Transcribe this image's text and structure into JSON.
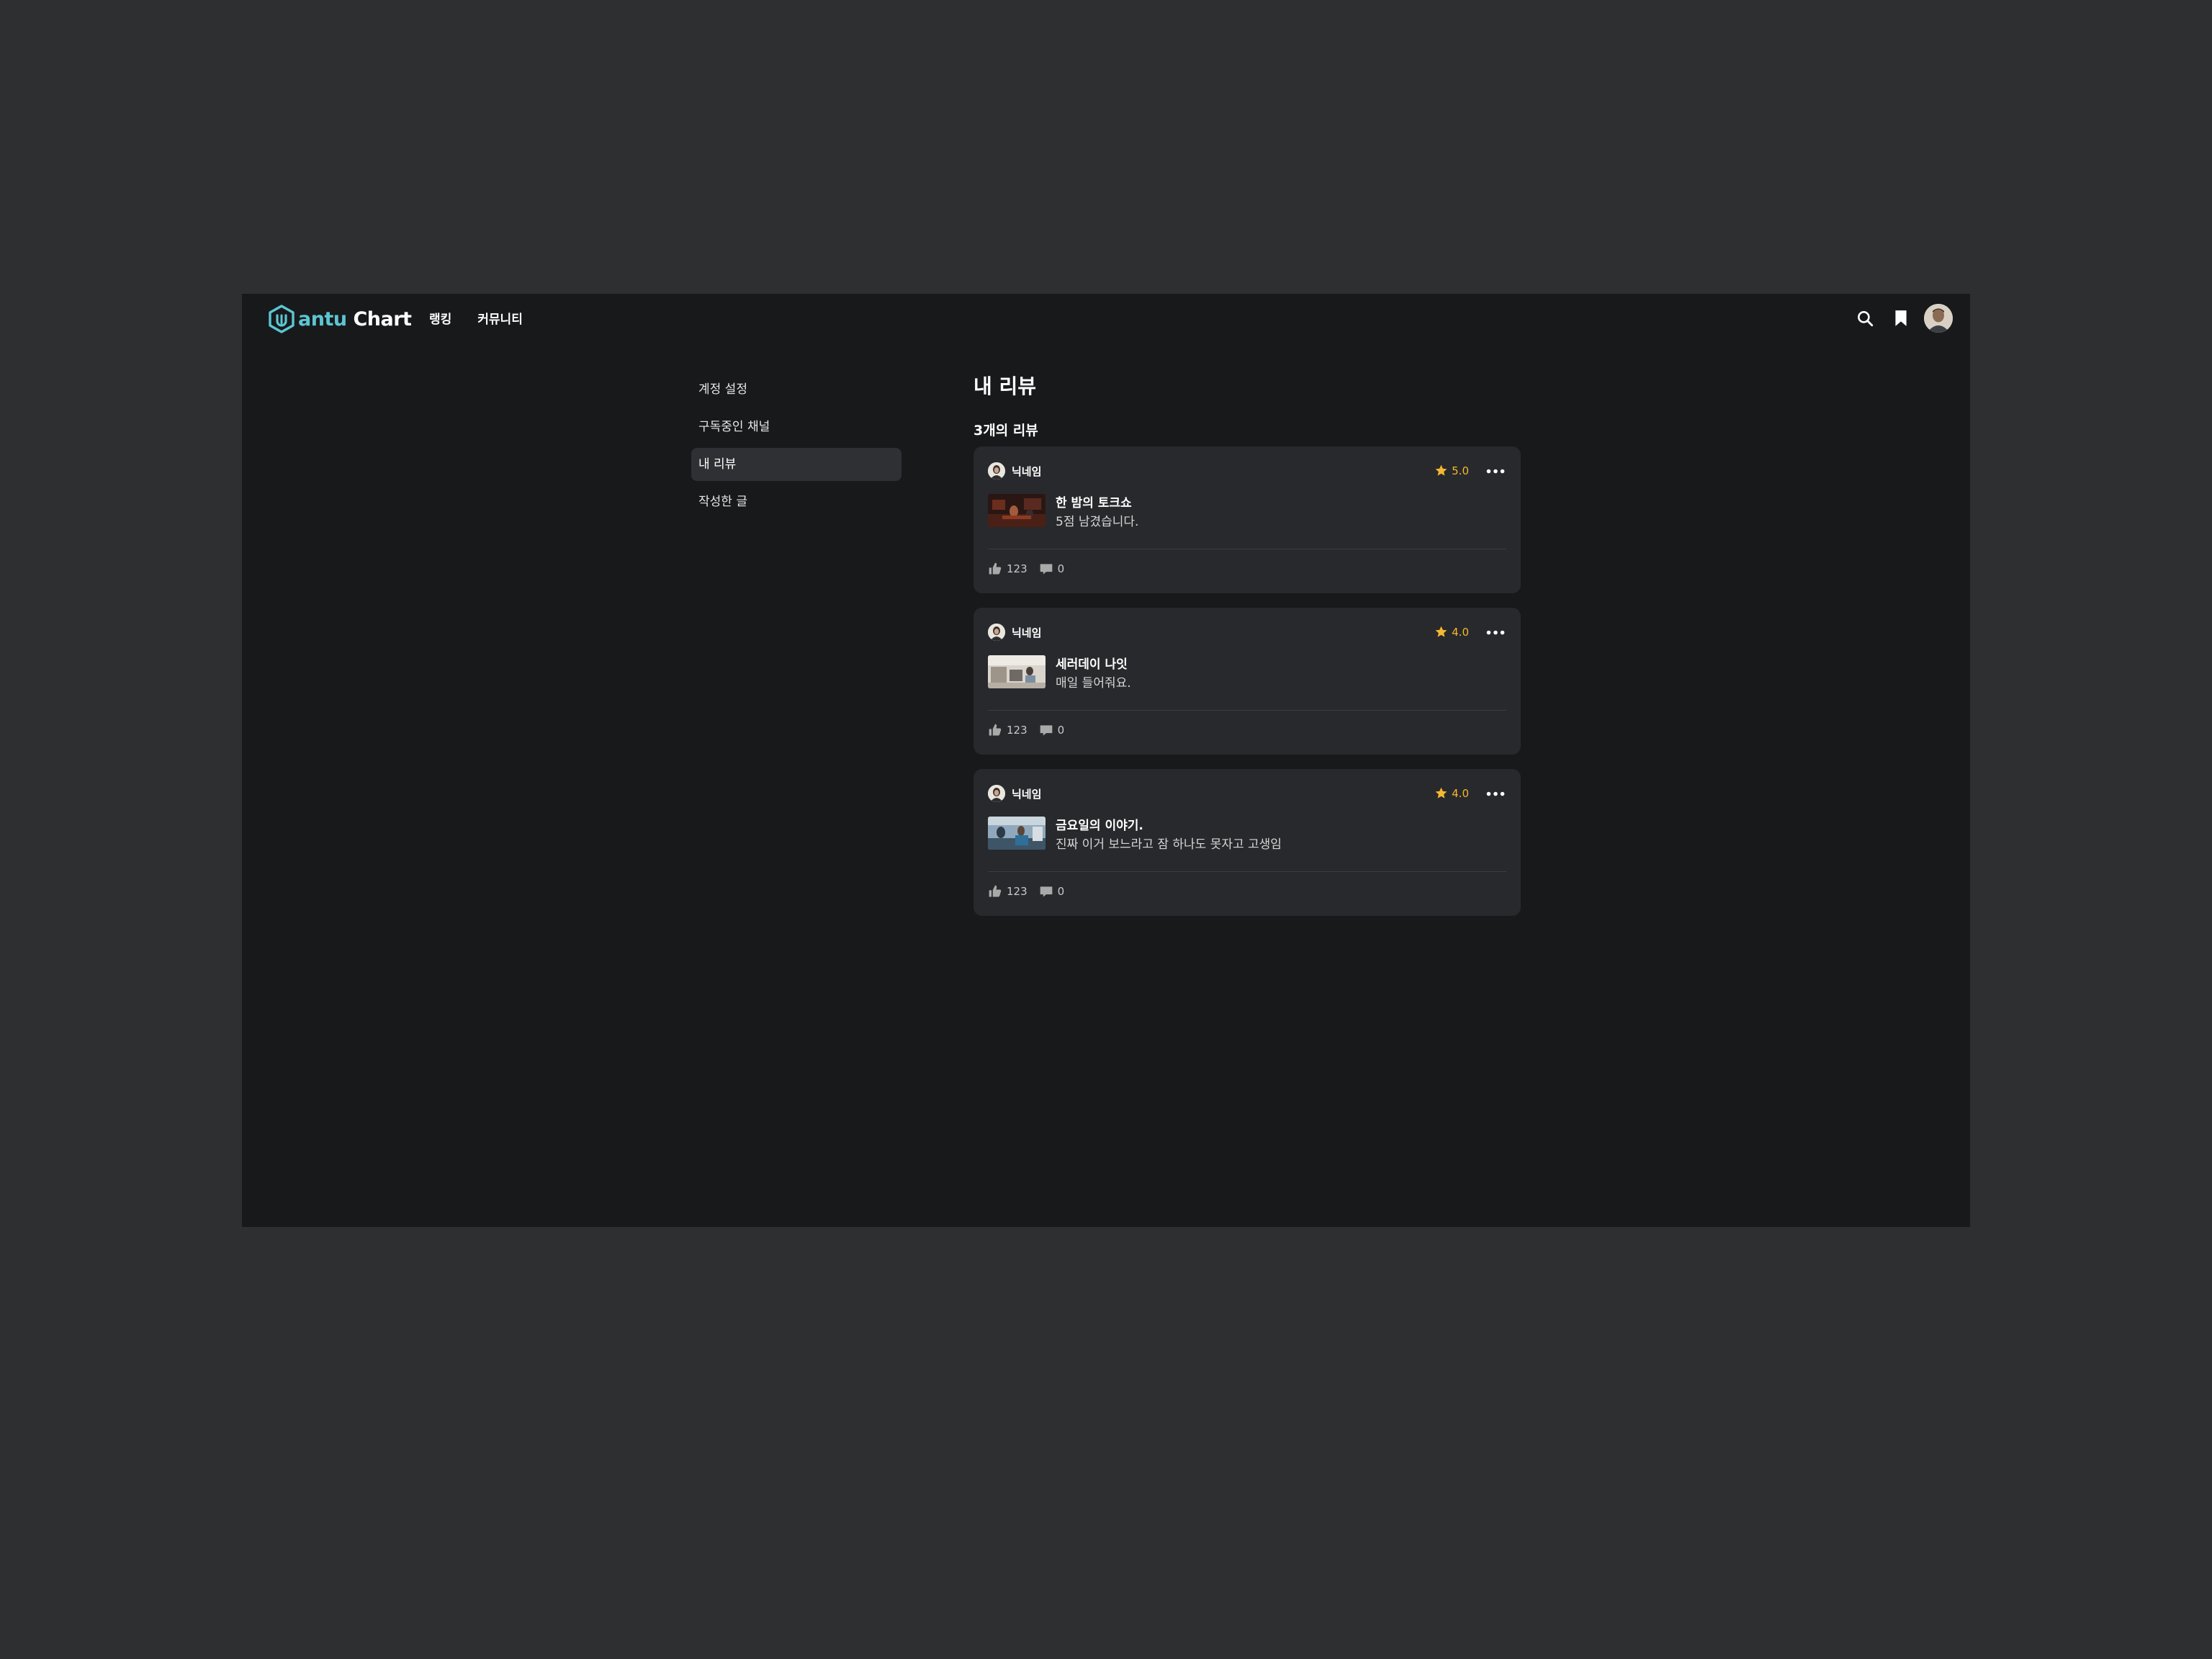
{
  "header": {
    "logo": {
      "accent": "antu",
      "rest": " Chart"
    },
    "nav": [
      "랭킹",
      "커뮤니티"
    ],
    "icons": [
      "search-icon",
      "bookmark-icon",
      "avatar"
    ]
  },
  "sidebar": {
    "items": [
      {
        "label": "계정 설정",
        "active": false
      },
      {
        "label": "구독중인 채널",
        "active": false
      },
      {
        "label": "내 리뷰",
        "active": true
      },
      {
        "label": "작성한 글",
        "active": false
      }
    ]
  },
  "main": {
    "title": "내 리뷰",
    "count_label": "3개의 리뷰",
    "reviews": [
      {
        "author": "닉네임",
        "rating": "5.0",
        "content_title": "한 밤의 토크쇼",
        "body": "5점 남겼습니다.",
        "likes": "123",
        "comments": "0"
      },
      {
        "author": "닉네임",
        "rating": "4.0",
        "content_title": "세러데이 나잇",
        "body": "매일 들어줘요.",
        "likes": "123",
        "comments": "0"
      },
      {
        "author": "닉네임",
        "rating": "4.0",
        "content_title": "금요일의 이야기.",
        "body": "진짜 이거 보느라고 잠 하나도 못자고 고생임",
        "likes": "123",
        "comments": "0"
      }
    ]
  },
  "colors": {
    "app_bg": "#18191b",
    "outer_bg": "#2e2f31",
    "card_bg": "#28292c",
    "brand": "#5bc6d2",
    "star": "#f5b731"
  }
}
